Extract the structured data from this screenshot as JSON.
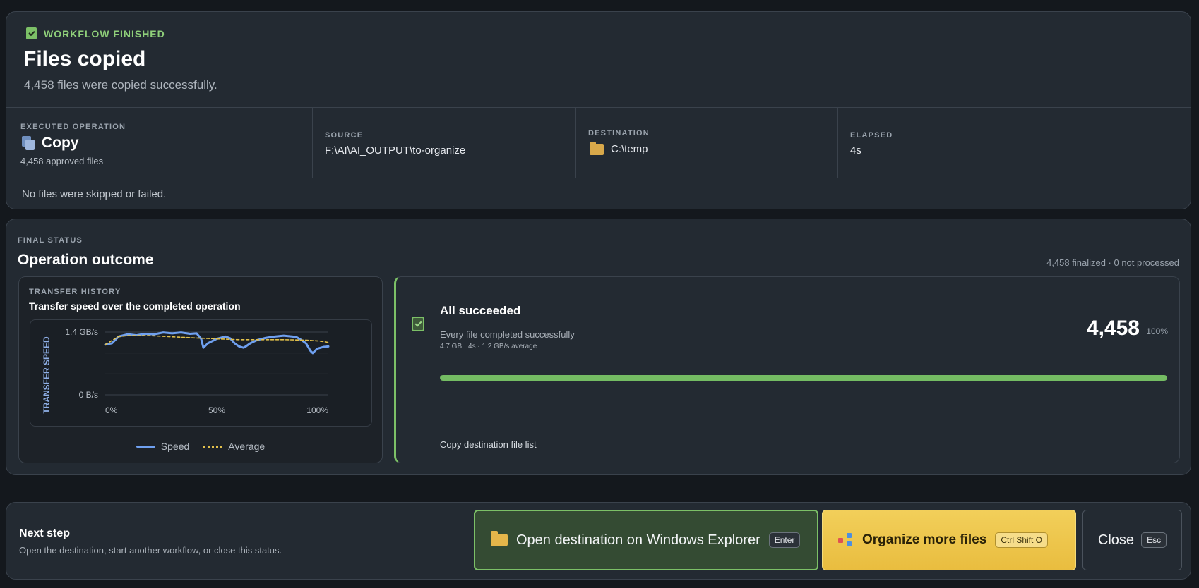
{
  "header": {
    "status_label": "WORKFLOW FINISHED",
    "title": "Files copied",
    "subtitle": "4,458 files were copied successfully."
  },
  "summary": {
    "operation_caption": "EXECUTED OPERATION",
    "operation_name": "Copy",
    "operation_note": "4,458 approved files",
    "source_caption": "SOURCE",
    "source_path": "F:\\AI\\AI_OUTPUT\\to-organize",
    "destination_caption": "DESTINATION",
    "destination_path": "C:\\temp",
    "elapsed_caption": "ELAPSED",
    "elapsed_value": "4s",
    "skip_note": "No files were skipped or failed."
  },
  "outcome": {
    "caption": "FINAL STATUS",
    "title": "Operation outcome",
    "finalized_note": "4,458 finalized · 0 not processed",
    "history_caption": "TRANSFER HISTORY",
    "history_title": "Transfer speed over the completed operation",
    "success_title": "All succeeded",
    "success_desc": "Every file completed successfully",
    "success_stats": "4.7 GB · 4s · 1.2 GB/s average",
    "success_count": "4,458",
    "success_pct_label": "100%",
    "success_fraction": 1.0,
    "copy_link": "Copy destination file list"
  },
  "chart_data": {
    "type": "line",
    "title": "Transfer speed over the completed operation",
    "xlabel": "",
    "ylabel": "TRANSFER SPEED",
    "x_tick_labels": [
      "0%",
      "50%",
      "100%"
    ],
    "y_tick_labels": [
      "1.4 GB/s",
      "0 B/s"
    ],
    "ylim": [
      0,
      1.4
    ],
    "xlim": [
      0,
      100
    ],
    "legend": "bottom",
    "series": [
      {
        "name": "Speed",
        "color": "#6fa0f0",
        "x": [
          0,
          3,
          6,
          10,
          14,
          18,
          22,
          26,
          30,
          34,
          38,
          41,
          43,
          44,
          46,
          50,
          54,
          56,
          58,
          60,
          62,
          63,
          65,
          68,
          72,
          76,
          80,
          84,
          86,
          88,
          90,
          92,
          93,
          95,
          98,
          100
        ],
        "y": [
          1.12,
          1.15,
          1.3,
          1.35,
          1.33,
          1.36,
          1.35,
          1.39,
          1.37,
          1.39,
          1.36,
          1.37,
          1.25,
          1.05,
          1.15,
          1.25,
          1.3,
          1.26,
          1.15,
          1.08,
          1.05,
          1.08,
          1.15,
          1.22,
          1.27,
          1.3,
          1.32,
          1.3,
          1.28,
          1.22,
          1.15,
          0.98,
          0.93,
          1.03,
          1.07,
          1.08
        ]
      },
      {
        "name": "Average",
        "color": "#e2c04b",
        "x": [
          0,
          6,
          10,
          20,
          40,
          60,
          80,
          90,
          96,
          100
        ],
        "y": [
          1.12,
          1.3,
          1.32,
          1.32,
          1.27,
          1.23,
          1.23,
          1.22,
          1.2,
          1.17
        ]
      }
    ]
  },
  "footer": {
    "next_title": "Next step",
    "next_desc": "Open the destination, start another workflow, or close this status.",
    "open_label": "Open destination on Windows Explorer",
    "open_key": "Enter",
    "organize_label": "Organize more files",
    "organize_key": "Ctrl Shift O",
    "close_label": "Close",
    "close_key": "Esc"
  }
}
